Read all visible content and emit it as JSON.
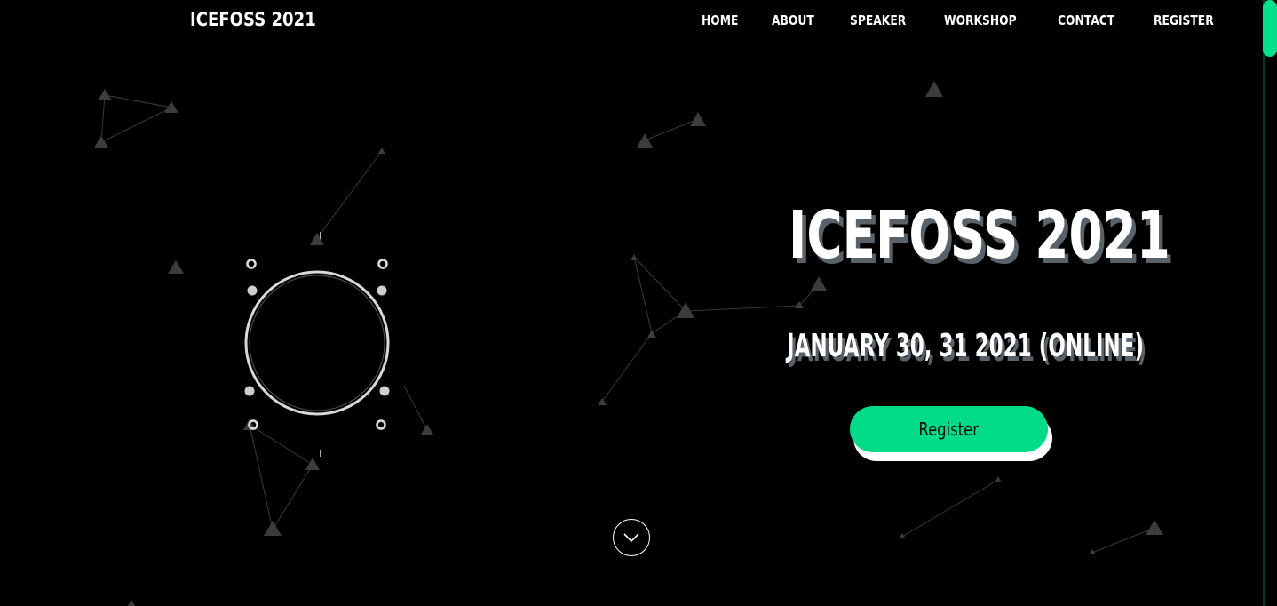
{
  "header": {
    "brand": "ICEFOSS 2021",
    "nav": [
      "HOME",
      "ABOUT",
      "SPEAKER",
      "WORKSHOP",
      "CONTACT",
      "REGISTER"
    ]
  },
  "hero": {
    "title": "ICEFOSS 2021",
    "date": "JANUARY 30, 31 2021 (ONLINE)",
    "register_label": "Register"
  },
  "colors": {
    "background": "#000000",
    "accent": "#00db87",
    "text_shadow": "#5a6168"
  },
  "icons": {
    "scroll_down": "chevron-down-icon",
    "loader": "ring-loader-icon"
  }
}
